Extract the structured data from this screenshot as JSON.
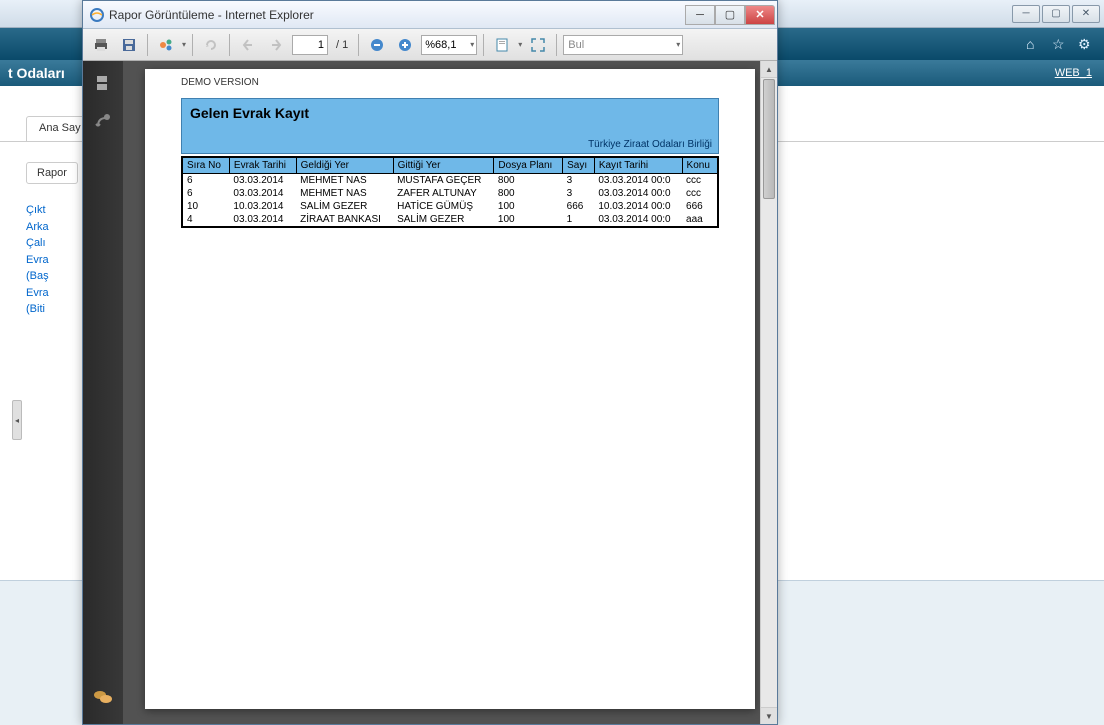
{
  "bg": {
    "banner_text": "t Odaları",
    "web_link": "WEB_1",
    "tab_label": "Ana Say",
    "subtab_label": "Rapor",
    "side_items": [
      "Çıkt",
      "Arka",
      "Çalı",
      "Evra",
      "(Baş",
      "Evra",
      "(Biti"
    ]
  },
  "window": {
    "title": "Rapor Görüntüleme - Internet Explorer"
  },
  "toolbar": {
    "page_current": "1",
    "page_total": "/ 1",
    "zoom_label": "%68,1",
    "search_placeholder": "Bul"
  },
  "report": {
    "demo": "DEMO VERSION",
    "title": "Gelen Evrak Kayıt",
    "org": "Türkiye Ziraat Odaları Birliği",
    "columns": [
      "Sıra No",
      "Evrak Tarihi",
      "Geldiği Yer",
      "Gittiği Yer",
      "Dosya Planı",
      "Sayı",
      "Kayıt Tarihi",
      "Konu"
    ],
    "rows": [
      [
        "6",
        "03.03.2014",
        "MEHMET NAS",
        "MUSTAFA GEÇER",
        "800",
        "3",
        "03.03.2014 00:0",
        "ccc"
      ],
      [
        "6",
        "03.03.2014",
        "MEHMET NAS",
        "ZAFER ALTUNAY",
        "800",
        "3",
        "03.03.2014 00:0",
        "ccc"
      ],
      [
        "10",
        "10.03.2014",
        "SALİM GEZER",
        "HATİCE GÜMÜŞ",
        "100",
        "666",
        "10.03.2014 00:0",
        "666"
      ],
      [
        "4",
        "03.03.2014",
        "ZİRAAT BANKASI",
        "SALİM GEZER",
        "100",
        "1",
        "03.03.2014 00:0",
        "aaa"
      ]
    ]
  }
}
